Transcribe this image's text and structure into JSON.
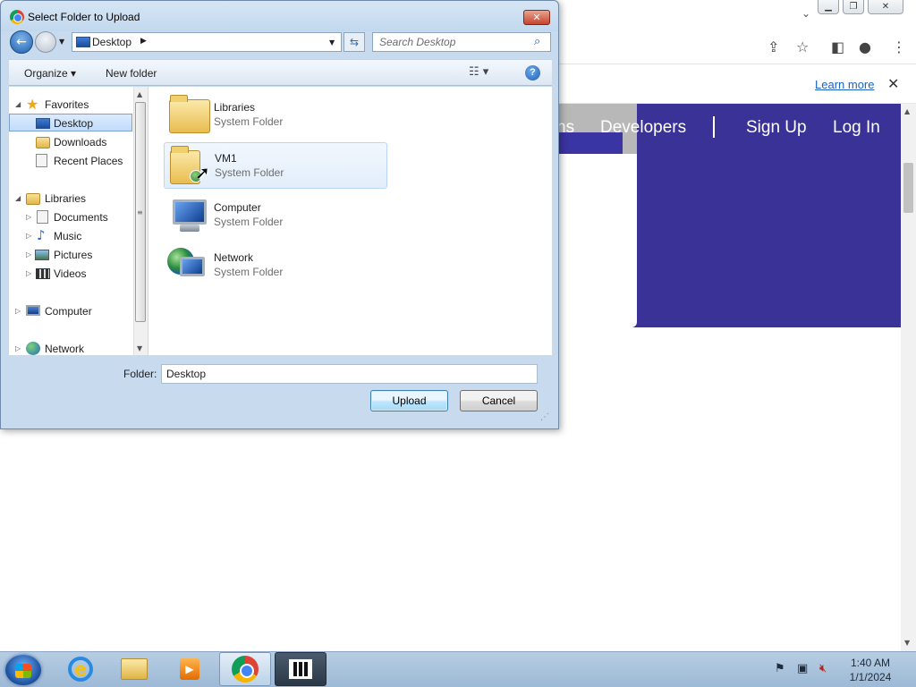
{
  "browser": {
    "learn_more": "Learn more",
    "nav_links": [
      "ns",
      "Developers",
      "Sign Up",
      "Log In"
    ],
    "icons": [
      "share-icon",
      "star-icon",
      "sidepanel-icon",
      "profile-icon",
      "menu-icon"
    ]
  },
  "dialog": {
    "title": "Select Folder to Upload",
    "address": "Desktop",
    "search_placeholder": "Search Desktop",
    "toolbar": {
      "organize": "Organize ▾",
      "new_folder": "New folder"
    },
    "nav_tree": {
      "favorites": "Favorites",
      "desktop": "Desktop",
      "downloads": "Downloads",
      "recent_places": "Recent Places",
      "libraries": "Libraries",
      "documents": "Documents",
      "music": "Music",
      "pictures": "Pictures",
      "videos": "Videos",
      "computer": "Computer",
      "network": "Network"
    },
    "items": [
      {
        "name": "Libraries",
        "type": "System Folder"
      },
      {
        "name": "VM1",
        "type": "System Folder"
      },
      {
        "name": "Computer",
        "type": "System Folder"
      },
      {
        "name": "Network",
        "type": "System Folder"
      }
    ],
    "folder_label": "Folder:",
    "folder_value": "Desktop",
    "upload_label": "Upload",
    "cancel_label": "Cancel"
  },
  "taskbar": {
    "apps": [
      "internet-explorer",
      "file-explorer",
      "media-player",
      "chrome",
      "video-app"
    ],
    "time": "1:40 AM",
    "date": "1/1/2024"
  }
}
